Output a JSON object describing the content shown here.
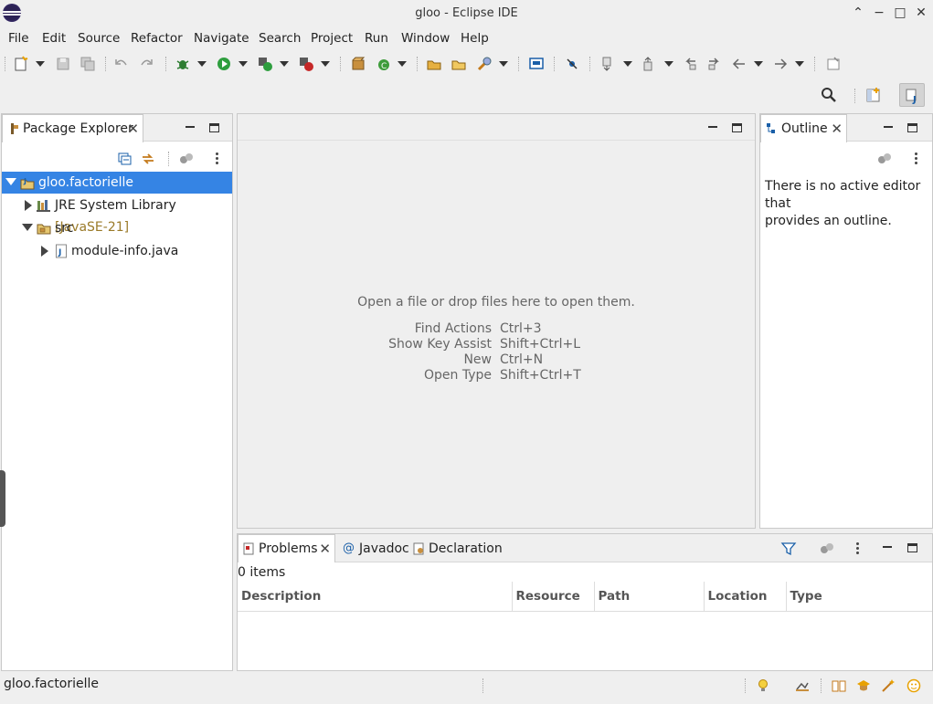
{
  "window": {
    "title": "gloo - Eclipse IDE"
  },
  "menu": [
    "File",
    "Edit",
    "Source",
    "Refactor",
    "Navigate",
    "Search",
    "Project",
    "Run",
    "Window",
    "Help"
  ],
  "toolbar_icons": [
    "new-icon",
    "save-icon",
    "save-all-icon",
    "undo-icon",
    "redo-icon",
    "debug-icon",
    "run-icon",
    "coverage-icon",
    "run-external-icon",
    "new-java-package-icon",
    "new-java-class-icon",
    "open-type-icon",
    "open-task-icon",
    "search-icon",
    "terminal-icon",
    "skip-breakpoints-icon",
    "next-annotation-icon",
    "previous-annotation-icon",
    "last-edit-icon",
    "back-icon",
    "forward-icon",
    "pin-editor-icon"
  ],
  "package_explorer": {
    "tab_label": "Package Explorer",
    "tree": [
      {
        "label": "gloo.factorielle",
        "icon": "java-project-icon",
        "expanded": true,
        "selected": true
      },
      {
        "label": "JRE System Library",
        "decoration": "[JavaSE-21]",
        "icon": "library-icon",
        "expanded": false
      },
      {
        "label": "src",
        "icon": "source-folder-icon",
        "expanded": true
      },
      {
        "label": "module-info.java",
        "icon": "java-file-icon",
        "expanded": false
      }
    ]
  },
  "editor_area": {
    "message": "Open a file or drop files here to open them.",
    "shortcuts": [
      {
        "action": "Find Actions",
        "keys": "Ctrl+3"
      },
      {
        "action": "Show Key Assist",
        "keys": "Shift+Ctrl+L"
      },
      {
        "action": "New",
        "keys": "Ctrl+N"
      },
      {
        "action": "Open Type",
        "keys": "Shift+Ctrl+T"
      }
    ]
  },
  "outline": {
    "tab_label": "Outline",
    "message_line1": "There is no active editor that",
    "message_line2": "provides an outline."
  },
  "bottom_panel": {
    "tabs": [
      "Problems",
      "Javadoc",
      "Declaration"
    ],
    "count": "0 items",
    "columns": [
      "Description",
      "Resource",
      "Path",
      "Location",
      "Type"
    ]
  },
  "status": {
    "text": "gloo.factorielle"
  }
}
